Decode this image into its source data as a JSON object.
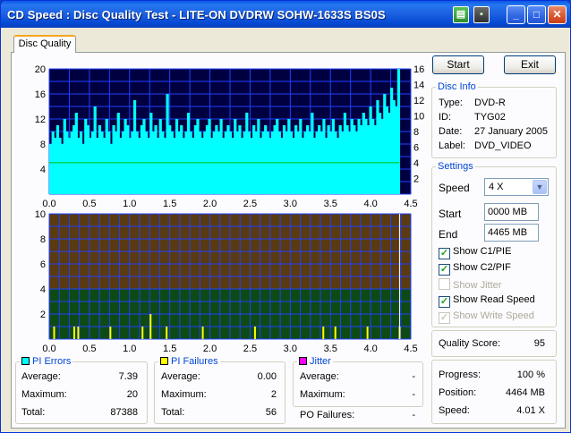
{
  "window": {
    "title": "CD Speed : Disc Quality Test - LITE-ON DVDRW SOHW-1633S BS0S"
  },
  "tabs": [
    {
      "label": "Disc Quality"
    }
  ],
  "buttons": {
    "start": "Start",
    "exit": "Exit"
  },
  "disc_info": {
    "legend": "Disc Info",
    "type_label": "Type:",
    "type": "DVD-R",
    "id_label": "ID:",
    "id": "TYG02",
    "date_label": "Date:",
    "date": "27 January 2005",
    "label_label": "Label:",
    "label": "DVD_VIDEO"
  },
  "settings": {
    "legend": "Settings",
    "speed_label": "Speed",
    "speed_value": "4 X",
    "start_label": "Start",
    "start_value": "0000 MB",
    "end_label": "End",
    "end_value": "4465 MB",
    "checks": [
      {
        "label": "Show C1/PIE",
        "checked": true,
        "enabled": true
      },
      {
        "label": "Show C2/PIF",
        "checked": true,
        "enabled": true
      },
      {
        "label": "Show Jitter",
        "checked": false,
        "enabled": false
      },
      {
        "label": "Show Read Speed",
        "checked": true,
        "enabled": true
      },
      {
        "label": "Show Write Speed",
        "checked": true,
        "enabled": false
      }
    ]
  },
  "quality": {
    "label": "Quality Score:",
    "value": "95"
  },
  "progress": {
    "progress_label": "Progress:",
    "progress_value": "100 %",
    "position_label": "Position:",
    "position_value": "4464 MB",
    "speed_label": "Speed:",
    "speed_value": "4.01 X"
  },
  "pi_errors": {
    "legend": "PI Errors",
    "avg_label": "Average:",
    "avg": "7.39",
    "max_label": "Maximum:",
    "max": "20",
    "total_label": "Total:",
    "total": "87388"
  },
  "pi_failures": {
    "legend": "PI Failures",
    "avg_label": "Average:",
    "avg": "0.00",
    "max_label": "Maximum:",
    "max": "2",
    "total_label": "Total:",
    "total": "56"
  },
  "jitter": {
    "legend": "Jitter",
    "avg_label": "Average:",
    "avg": "-",
    "max_label": "Maximum:",
    "max": "-"
  },
  "po_failures": {
    "label": "PO Failures:",
    "value": "-"
  },
  "colors": {
    "pie": "#00ffff",
    "pif": "#ffff00",
    "jitter": "#ff00ff",
    "speed": "#00c000",
    "top_bg": "#000040",
    "bot_bg_high": "#5a3a10",
    "bot_bg_low": "#0e4a14",
    "grid": "#2040ff"
  },
  "chart_data": [
    {
      "type": "area",
      "name": "PI Errors",
      "x_ticks": [
        "0.0",
        "0.5",
        "1.0",
        "1.5",
        "2.0",
        "2.5",
        "3.0",
        "3.5",
        "4.0",
        "4.5"
      ],
      "y_left_ticks": [
        "20",
        "16",
        "12",
        "8",
        "4"
      ],
      "y_right_ticks": [
        "16",
        "14",
        "12",
        "10",
        "8",
        "6",
        "4",
        "2"
      ],
      "xlim": [
        0,
        4.5
      ],
      "ylim_left": [
        0,
        20
      ],
      "ylim_right": [
        0,
        16
      ],
      "pie_samples": [
        8,
        10,
        9,
        11,
        9,
        8,
        12,
        10,
        9,
        10,
        11,
        13,
        9,
        10,
        8,
        12,
        11,
        9,
        10,
        14,
        9,
        11,
        10,
        9,
        12,
        10,
        8,
        11,
        10,
        13,
        9,
        10,
        12,
        11,
        9,
        10,
        15,
        10,
        9,
        11,
        12,
        10,
        9,
        13,
        10,
        11,
        9,
        12,
        10,
        9,
        16,
        11,
        10,
        9,
        12,
        10,
        11,
        9,
        10,
        13,
        10,
        9,
        11,
        12,
        10,
        9,
        10,
        11,
        12,
        9,
        10,
        11,
        10,
        12,
        9,
        10,
        11,
        10,
        9,
        12,
        10,
        11,
        9,
        10,
        13,
        10,
        9,
        11,
        10,
        12,
        9,
        10,
        11,
        10,
        9,
        10,
        11,
        12,
        10,
        9,
        11,
        10,
        12,
        10,
        9,
        11,
        10,
        12,
        9,
        10,
        11,
        10,
        13,
        9,
        10,
        11,
        10,
        12,
        9,
        11,
        10,
        12,
        10,
        9,
        11,
        10,
        13,
        11,
        10,
        12,
        11,
        10,
        12,
        11,
        13,
        12,
        11,
        14,
        12,
        11,
        15,
        13,
        12,
        16,
        14,
        13,
        17,
        15,
        14,
        20
      ],
      "speed_x": 4.36,
      "speed_value": 4.01
    },
    {
      "type": "bar",
      "name": "PI Failures",
      "x_ticks": [
        "0.0",
        "0.5",
        "1.0",
        "1.5",
        "2.0",
        "2.5",
        "3.0",
        "3.5",
        "4.0",
        "4.5"
      ],
      "y_ticks": [
        "10",
        "8",
        "6",
        "4",
        "2"
      ],
      "xlim": [
        0,
        4.5
      ],
      "ylim": [
        0,
        10
      ],
      "pif_points": [
        [
          0.05,
          1
        ],
        [
          0.3,
          1
        ],
        [
          0.35,
          1
        ],
        [
          0.75,
          1
        ],
        [
          1.15,
          1
        ],
        [
          1.25,
          2
        ],
        [
          1.45,
          1
        ],
        [
          1.9,
          1
        ],
        [
          2.55,
          1
        ],
        [
          3.4,
          1
        ],
        [
          3.55,
          1
        ],
        [
          3.95,
          1
        ],
        [
          4.35,
          1
        ]
      ]
    }
  ]
}
